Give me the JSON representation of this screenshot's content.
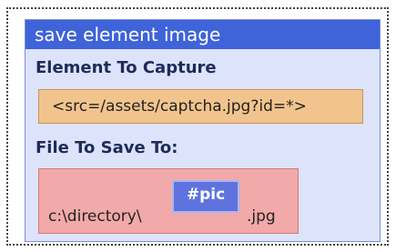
{
  "panel": {
    "title": "save element image",
    "capture_label": "Element To Capture",
    "capture_value": "<src=/assets/captcha.jpg?id=*>",
    "save_label": "File To Save To:",
    "path_prefix": "c:\\directory\\",
    "variable": "#pic",
    "path_suffix": ".jpg"
  },
  "colors": {
    "title_bar": "#3f63d9",
    "panel_bg": "#dce3fb",
    "selector_bg": "#f2c48d",
    "file_bg": "#f1a9a9",
    "variable_chip": "#5f73de"
  }
}
